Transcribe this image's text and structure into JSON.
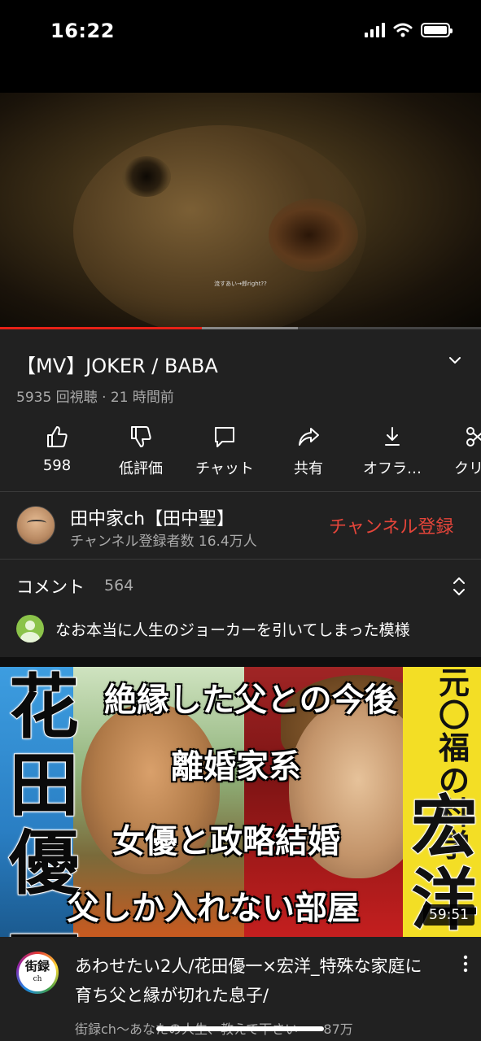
{
  "status_bar": {
    "time": "16:22"
  },
  "player": {
    "subtitle": "流すあい→郎right??",
    "progress_fraction": 0.42,
    "buffered_fraction": 0.62
  },
  "video": {
    "title": "【MV】JOKER / BABA",
    "meta": "5935 回視聴 · 21 時間前"
  },
  "actions": [
    {
      "label": "598",
      "icon": "thumbs-up-icon"
    },
    {
      "label": "低評価",
      "icon": "thumbs-down-icon"
    },
    {
      "label": "チャット",
      "icon": "chat-icon"
    },
    {
      "label": "共有",
      "icon": "share-icon"
    },
    {
      "label": "オフラ…",
      "icon": "download-icon"
    },
    {
      "label": "クリ…",
      "icon": "scissors-icon"
    }
  ],
  "channel": {
    "name": "田中家ch【田中聖】",
    "subscribers": "チャンネル登録者数 16.4万人",
    "subscribe_label": "チャンネル登録"
  },
  "comments": {
    "title": "コメント",
    "count": "564",
    "top_comment": "なお本当に人生のジョーカーを引いてしまった模様"
  },
  "recommended": {
    "thumbnail": {
      "left_name": "花田優一",
      "right_top": "元〇福の科学",
      "right_name": "宏洋",
      "captions": [
        "絶縁した父との今後",
        "離婚家系",
        "女優と政略結婚",
        "父しか入れない部屋"
      ],
      "duration": "59:51"
    },
    "avatar_text": "街録",
    "avatar_sub": "ch",
    "title": "あわせたい2人/花田優一×宏洋_特殊な家庭に育ち父と縁が切れた息子/",
    "meta": "街録ch〜あなたの人生、教えて下さい〜 · 87万"
  },
  "colors": {
    "background": "#212121",
    "accent_red": "#e62117",
    "subscribe_red": "#e5453a"
  }
}
